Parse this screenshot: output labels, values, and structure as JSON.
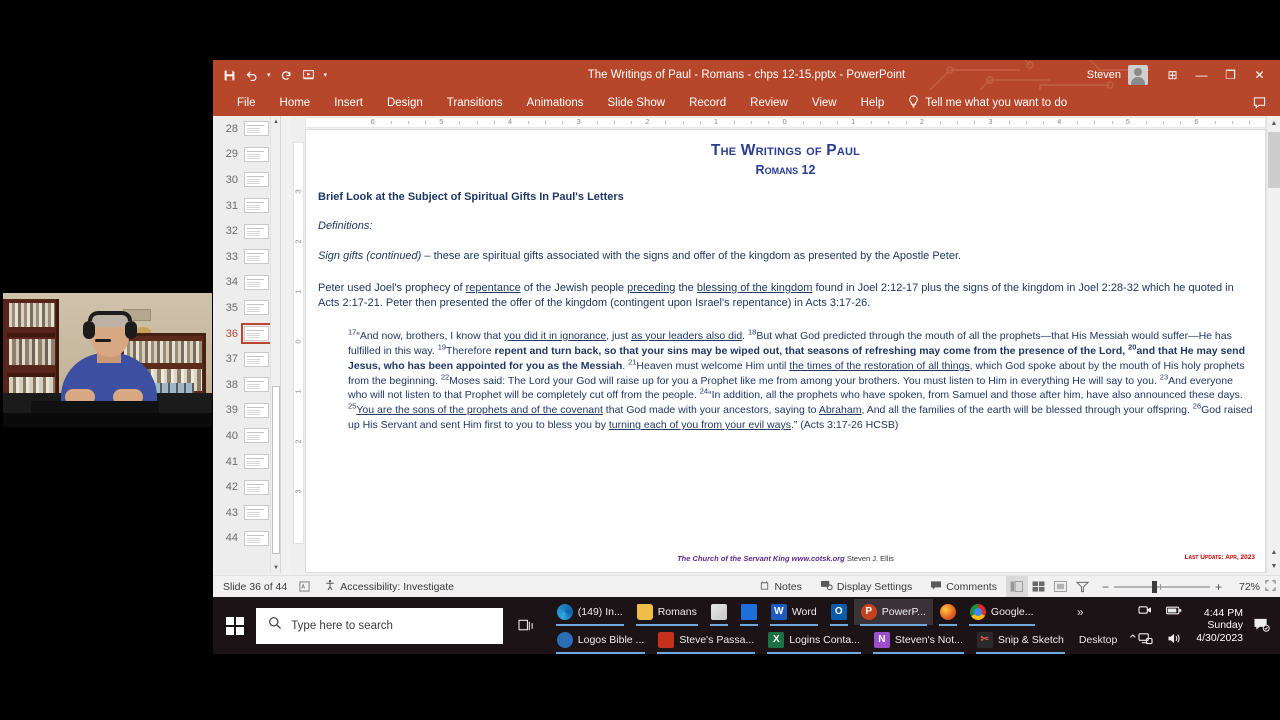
{
  "app": {
    "title": "The Writings of Paul - Romans - chps 12-15.pptx  -  PowerPoint",
    "user": "Steven",
    "quick_access": [
      "save-icon",
      "undo-icon",
      "redo-icon",
      "start-from-beginning-icon",
      "customize-icon"
    ],
    "window_controls": {
      "ribbon_display": "⊞",
      "minimize": "—",
      "restore": "❐",
      "close": "✕"
    }
  },
  "ribbon": {
    "tabs": [
      "File",
      "Home",
      "Insert",
      "Design",
      "Transitions",
      "Animations",
      "Slide Show",
      "Record",
      "Review",
      "View",
      "Help"
    ],
    "tell_me": "Tell me what you want to do",
    "comment_icon": "comment-icon"
  },
  "thumbnails": {
    "slides": [
      {
        "n": "28"
      },
      {
        "n": "29"
      },
      {
        "n": "30"
      },
      {
        "n": "31"
      },
      {
        "n": "32"
      },
      {
        "n": "33"
      },
      {
        "n": "34"
      },
      {
        "n": "35"
      },
      {
        "n": "36"
      },
      {
        "n": "37"
      },
      {
        "n": "38"
      },
      {
        "n": "39"
      },
      {
        "n": "40"
      },
      {
        "n": "41"
      },
      {
        "n": "42"
      },
      {
        "n": "43"
      },
      {
        "n": "44"
      }
    ],
    "active": "36"
  },
  "rulers": {
    "horizontal": [
      "6",
      "5",
      "4",
      "3",
      "2",
      "1",
      "0",
      "1",
      "2",
      "3",
      "4",
      "5",
      "6"
    ],
    "vertical": [
      "3",
      "2",
      "1",
      "0",
      "1",
      "2",
      "3"
    ]
  },
  "slide": {
    "title": "The Writings of Paul",
    "subtitle": "Romans 12",
    "heading": "Brief Look at the Subject of Spiritual Gifts In Paul's Letters",
    "definitions_label": "Definitions:",
    "sign_gifts_lead": "Sign gifts (continued)",
    "sign_gifts_rest": " – these are spiritual gifts associated with the signs and offer of the kingdom as presented by the Apostle Peter.",
    "paragraph_peter": {
      "p1": "Peter used Joel's prophecy of ",
      "u1": "repentance",
      "p2": " of the Jewish people ",
      "u2": "preceding",
      "p3": " the ",
      "u3": "blessing of the kingdom",
      "p4": " found in Joel 2:12-17 plus the signs of the kingdom in Joel 2:28-32 which he quoted in Acts 2:17-21.  Peter then presented the offer of the kingdom (contingent upon Israel's repentance) in Acts 3:17-26."
    },
    "quote": {
      "v17": "17",
      "q1": "“And now, brothers, I know that ",
      "u1": "you did it in ignorance",
      "q2": ", just ",
      "u2": "as your leaders also did",
      "q3": ". ",
      "v18": "18",
      "q4": "But what God predicted through the mouth of all the prophets—that His Messiah would suffer—He has fulfilled in this way. ",
      "v19": "19",
      "q5": "Therefore ",
      "bold1": "repent and turn back, so that your sins may be wiped out, that seasons of refreshing may come from the presence of the Lord, ",
      "v20": "20",
      "bold2": "and that He may send Jesus, who has been appointed for you as the Messiah",
      "q6": ". ",
      "v21": "21",
      "q7": "Heaven must welcome Him until ",
      "u3": "the times of the restoration of all things",
      "q8": ", which God spoke about by the mouth of His holy prophets from the beginning. ",
      "v22": "22",
      "q9": "Moses said: The Lord your God will raise up for you a Prophet like me from among your brothers. You must listen to Him in everything He will say to you. ",
      "v23": "23",
      "q10": "And everyone who will not listen to that Prophet will be completely cut off from the people. ",
      "v24": "24",
      "q11": "“In addition, all the prophets who have spoken, from Samuel and those after him, have also announced these days. ",
      "v25": "25",
      "u4": "You are the sons of the prophets and of the covenant",
      "q12": " that God made with your ancestors, saying to ",
      "u5": "Abraham",
      "q13": ", And all the families of the earth will be blessed through your offspring. ",
      "v26": "26",
      "q14": "God raised up His Servant and sent Him first to you to bless you by ",
      "u6": "turning each of you from your evil ways",
      "q15": ".”  (Acts 3:17-26 HCSB)"
    },
    "footer_church": "The Church of the Servant King www.cotsk.org",
    "footer_author": " Steven J. Ellis",
    "footer_update": "Last Update:  Apr, 2023"
  },
  "statusbar": {
    "slide_count": "Slide 36 of 44",
    "language_icon": "language-icon",
    "accessibility": "Accessibility: Investigate",
    "notes": "Notes",
    "display_settings": "Display Settings",
    "comments": "Comments",
    "views": [
      "normal-view-icon",
      "slide-sorter-icon",
      "reading-view-icon",
      "slide-show-icon"
    ],
    "zoom_out": "−",
    "zoom_in": "+",
    "zoom_level": "72%",
    "fit_icon": "fit-to-window-icon"
  },
  "taskbar": {
    "start": "start-button",
    "search_placeholder": "Type here to search",
    "task_view": "task-view-icon",
    "row1": [
      {
        "label": "(149) In...",
        "icon": "edge-icon"
      },
      {
        "label": "Romans",
        "icon": "folder-icon"
      },
      {
        "label": "",
        "icon": "microsoft-store-icon"
      },
      {
        "label": "",
        "icon": "mail-icon"
      },
      {
        "label": "Word",
        "icon": "word-icon"
      },
      {
        "label": "",
        "icon": "outlook-icon"
      },
      {
        "label": "PowerP...",
        "icon": "powerpoint-icon",
        "active": true
      },
      {
        "label": "",
        "icon": "firefox-icon"
      },
      {
        "label": "Google...",
        "icon": "chrome-icon"
      }
    ],
    "row2": [
      {
        "label": "Logos Bible ...",
        "icon": "logos-bible-icon"
      },
      {
        "label": "Steve's Passa...",
        "icon": "pdf-icon"
      },
      {
        "label": "Logins Conta...",
        "icon": "excel-icon"
      },
      {
        "label": "Steven's Not...",
        "icon": "onenote-icon"
      },
      {
        "label": "Snip & Sketch",
        "icon": "snip-sketch-icon"
      }
    ],
    "overflow": "»",
    "desktop_label": "Desktop",
    "desktop_chevron": "⌃",
    "tray_icons": [
      "camera-icon",
      "battery-icon",
      "network-icon",
      "volume-icon"
    ],
    "clock_time": "4:44 PM",
    "clock_day": "Sunday",
    "clock_date": "4/30/2023",
    "notification_icon": "notification-icon"
  },
  "colors": {
    "ppt_accent": "#b7472a",
    "slide_text": "#1f3864",
    "title_blue": "#2b3d8f",
    "taskbar_bg": "#1b1316"
  }
}
